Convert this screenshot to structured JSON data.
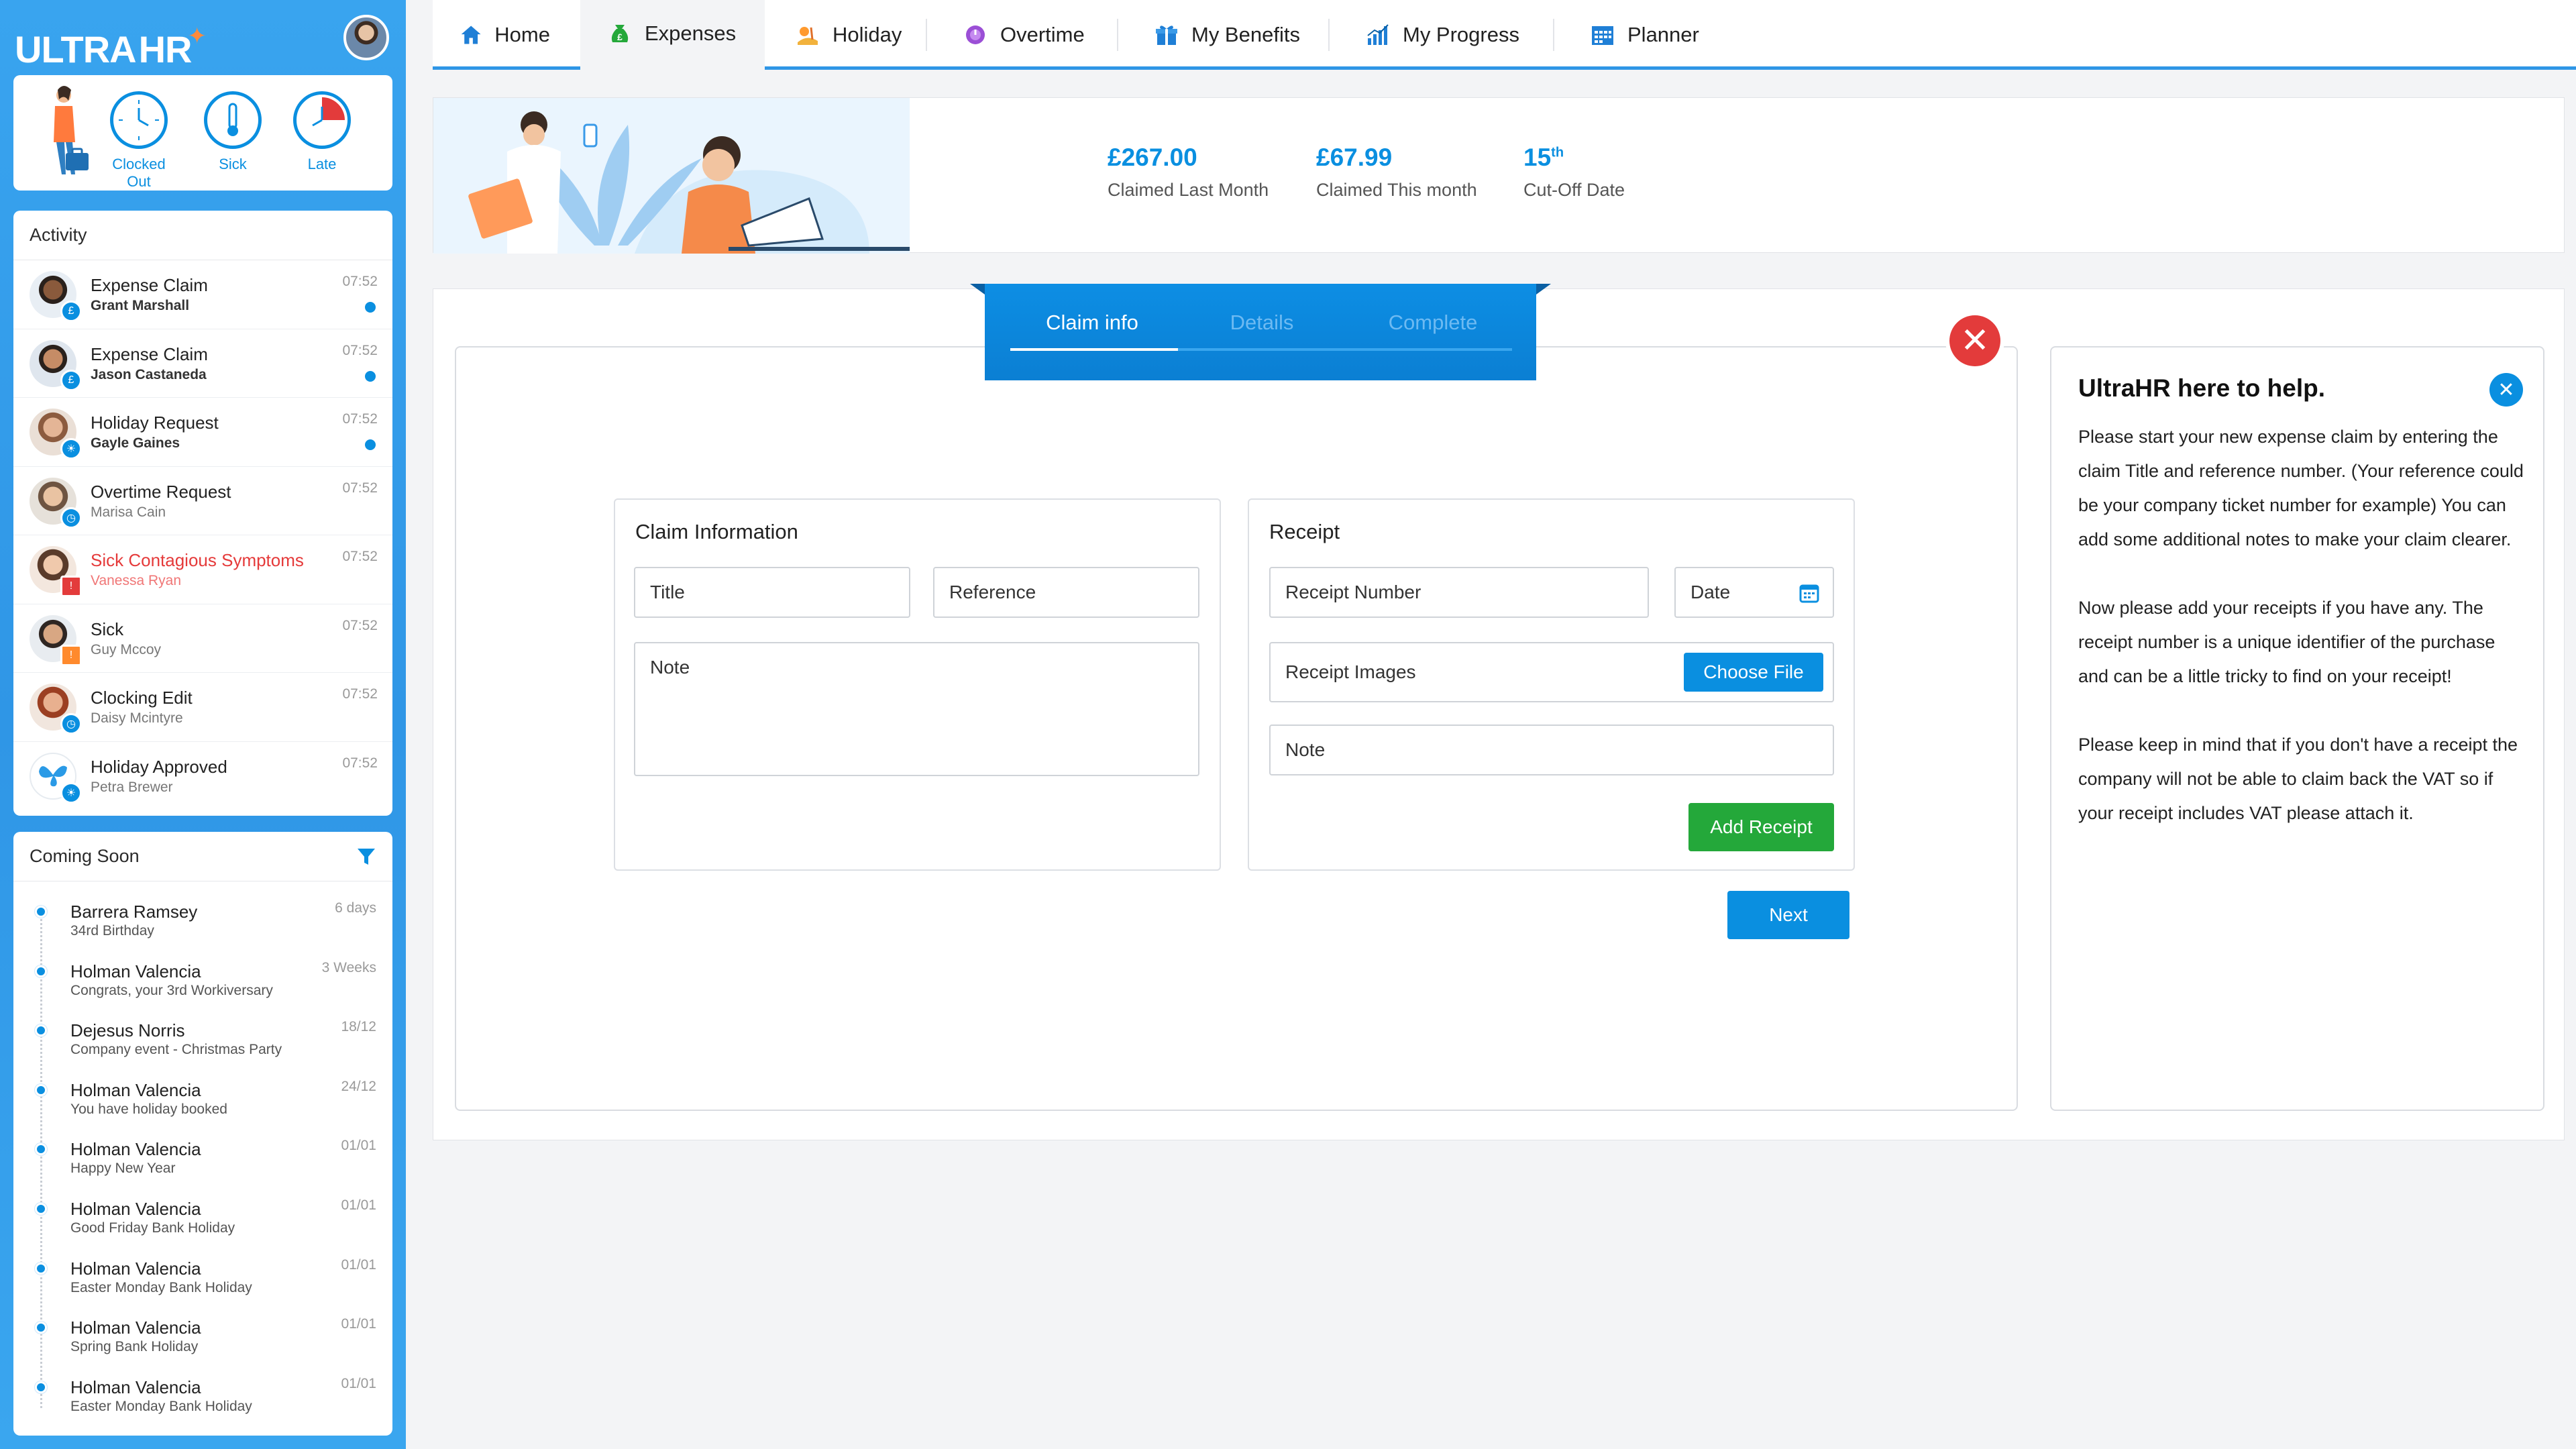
{
  "brand": {
    "ultra": "ULTRA",
    "hr": "HR"
  },
  "status": [
    {
      "label": "Clocked Out"
    },
    {
      "label": "Sick"
    },
    {
      "label": "Late"
    }
  ],
  "activity": {
    "title": "Activity",
    "items": [
      {
        "title": "Expense Claim",
        "name": "Grant Marshall",
        "time": "07:52",
        "unread": true,
        "icon": "expense-icon"
      },
      {
        "title": "Expense Claim",
        "name": "Jason Castaneda",
        "time": "07:52",
        "unread": true,
        "icon": "expense-icon"
      },
      {
        "title": "Holiday Request",
        "name": "Gayle Gaines",
        "time": "07:52",
        "unread": true,
        "icon": "holiday-icon"
      },
      {
        "title": "Overtime Request",
        "name": "Marisa Cain",
        "time": "07:52",
        "unread": false,
        "icon": "overtime-icon"
      },
      {
        "title": "Sick Contagious Symptoms",
        "name": "Vanessa Ryan",
        "time": "07:52",
        "unread": false,
        "icon": "warning-icon",
        "alert": true
      },
      {
        "title": "Sick",
        "name": "Guy Mccoy",
        "time": "07:52",
        "unread": false,
        "icon": "warning-icon"
      },
      {
        "title": "Clocking Edit",
        "name": "Daisy Mcintyre",
        "time": "07:52",
        "unread": false,
        "icon": "clock-icon"
      },
      {
        "title": "Holiday Approved",
        "name": "Petra Brewer",
        "time": "07:52",
        "unread": false,
        "icon": "holiday-icon"
      }
    ]
  },
  "coming_soon": {
    "title": "Coming Soon",
    "items": [
      {
        "name": "Barrera Ramsey",
        "desc": "34rd Birthday",
        "when": "6 days"
      },
      {
        "name": "Holman Valencia",
        "desc": "Congrats, your 3rd Workiversary",
        "when": "3 Weeks"
      },
      {
        "name": "Dejesus Norris",
        "desc": "Company event - Christmas Party",
        "when": "18/12"
      },
      {
        "name": "Holman Valencia",
        "desc": "You have holiday booked",
        "when": "24/12"
      },
      {
        "name": "Holman Valencia",
        "desc": "Happy New Year",
        "when": "01/01"
      },
      {
        "name": "Holman Valencia",
        "desc": "Good Friday Bank Holiday",
        "when": "01/01"
      },
      {
        "name": "Holman Valencia",
        "desc": "Easter Monday Bank Holiday",
        "when": "01/01"
      },
      {
        "name": "Holman Valencia",
        "desc": "Spring Bank Holiday",
        "when": "01/01"
      },
      {
        "name": "Holman Valencia",
        "desc": "Easter Monday Bank Holiday",
        "when": "01/01"
      }
    ]
  },
  "nav": {
    "tabs": [
      {
        "label": "Home",
        "icon": "home-icon"
      },
      {
        "label": "Expenses",
        "icon": "expenses-icon",
        "active": true
      },
      {
        "label": "Holiday",
        "icon": "holiday-icon"
      },
      {
        "label": "Overtime",
        "icon": "overtime-icon"
      },
      {
        "label": "My Benefits",
        "icon": "gift-icon"
      },
      {
        "label": "My Progress",
        "icon": "chart-icon"
      },
      {
        "label": "Planner",
        "icon": "calendar-icon"
      }
    ]
  },
  "summary": {
    "claimed_last": {
      "value": "£267.00",
      "label": "Claimed Last Month"
    },
    "claimed_this": {
      "value": "£67.99",
      "label": "Claimed This month"
    },
    "cutoff": {
      "value": "15",
      "suffix": "th",
      "label": "Cut-Off Date"
    }
  },
  "wizard": {
    "steps": [
      "Claim info",
      "Details",
      "Complete"
    ],
    "active": 0
  },
  "claim": {
    "heading": "Claim Information",
    "title_placeholder": "Title",
    "reference_placeholder": "Reference",
    "note_placeholder": "Note"
  },
  "receipt": {
    "heading": "Receipt",
    "number_placeholder": "Receipt Number",
    "date_placeholder": "Date",
    "images_label": "Receipt Images",
    "choose_file": "Choose File",
    "note_placeholder": "Note",
    "add_button": "Add Receipt"
  },
  "next_button": "Next",
  "help": {
    "title": "UltraHR here to help.",
    "paragraphs": [
      "Please start your new expense claim by entering the claim Title and reference number. (Your reference could be your company ticket number for example) You can add some additional notes to make your claim clearer.",
      "Now please add your receipts if you have any. The receipt number is a unique identifier of the purchase and can be a little tricky to find on your receipt!",
      "Please keep in mind that if you don't have a receipt the company will not be able to claim back the VAT so if your receipt includes VAT please attach it."
    ]
  },
  "colors": {
    "accent": "#0a8fe0",
    "success": "#24a83a",
    "danger": "#e33b3b"
  }
}
